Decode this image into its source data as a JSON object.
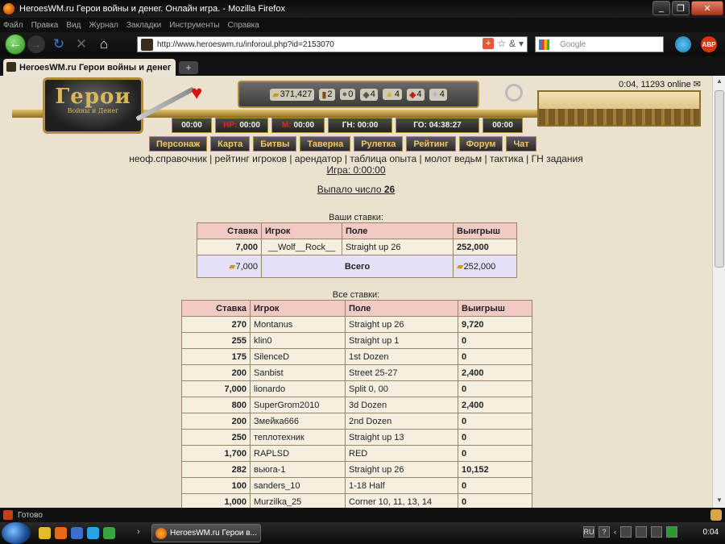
{
  "window": {
    "title": "HeroesWM.ru Герои войны и денег. Онлайн игра. - Mozilla Firefox",
    "buttons": [
      "_",
      "❐",
      "✕"
    ]
  },
  "menubar": [
    "Файл",
    "Правка",
    "Вид",
    "Журнал",
    "Закладки",
    "Инструменты",
    "Справка"
  ],
  "nav": {
    "url": "http://www.heroeswm.ru/inforoul.php?id=2153070",
    "search_placeholder": "Google"
  },
  "tab": {
    "title": "HeroesWM.ru Герои войны и денег",
    "new_tab": "+"
  },
  "game": {
    "logo_text": "Герои",
    "logo_sub": "Войны и Денег",
    "online": "0:04, 11293 online",
    "resources": [
      "371,427",
      "2",
      "0",
      "4",
      "4",
      "4",
      "4"
    ],
    "resource_icons": [
      "gold-icon",
      "wood-icon",
      "ore-icon",
      "mercury-icon",
      "sulfur-icon",
      "crystal-icon",
      "gems-icon"
    ],
    "timers": [
      {
        "label": "00:00",
        "width": 50
      },
      {
        "prefix": "HP:",
        "label": "00:00",
        "width": 66
      },
      {
        "prefix": "M:",
        "label": "00:00",
        "width": 66
      },
      {
        "label": "ГН: 00:00",
        "width": 80
      },
      {
        "label": "ГО: 04:38:27",
        "width": 104
      },
      {
        "label": "00:00",
        "width": 50
      }
    ],
    "menu": [
      "Персонаж",
      "Карта",
      "Битвы",
      "Таверна",
      "Рулетка",
      "Рейтинг",
      "Форум",
      "Чат"
    ],
    "links": [
      "неоф.справочник",
      "рейтинг игроков",
      "арендатор",
      "таблица опыта",
      "молот ведьм",
      "тактика",
      "ГН задания"
    ],
    "game_time": "Игра: 0:00:00"
  },
  "result": {
    "label": "Выпало число",
    "number": "26"
  },
  "your_bets": {
    "title": "Ваши ставки:",
    "headers": [
      "Ставка",
      "Игрок",
      "Поле",
      "Выигрыш"
    ],
    "rows": [
      [
        "7,000",
        "__Wolf__Rock__",
        "Straight up 26",
        "252,000"
      ]
    ],
    "total": {
      "bet": "7,000",
      "label": "Всего",
      "win": "252,000"
    }
  },
  "all_bets": {
    "title": "Все ставки:",
    "headers": [
      "Ставка",
      "Игрок",
      "Поле",
      "Выигрыш"
    ],
    "rows": [
      [
        "270",
        "Montanus",
        "Straight up 26",
        "9,720"
      ],
      [
        "255",
        "klin0",
        "Straight up 1",
        "0"
      ],
      [
        "175",
        "SilenceD",
        "1st Dozen",
        "0"
      ],
      [
        "200",
        "Sanbist",
        "Street 25-27",
        "2,400"
      ],
      [
        "7,000",
        "lionardo",
        "Split 0, 00",
        "0"
      ],
      [
        "800",
        "SuperGrom2010",
        "3d Dozen",
        "2,400"
      ],
      [
        "200",
        "Змейка666",
        "2nd Dozen",
        "0"
      ],
      [
        "250",
        "теплотехник",
        "Straight up 13",
        "0"
      ],
      [
        "1,700",
        "RAPLSD",
        "RED",
        "0"
      ],
      [
        "282",
        "вьюга-1",
        "Straight up 26",
        "10,152"
      ],
      [
        "100",
        "sanders_10",
        "1-18 Half",
        "0"
      ],
      [
        "1,000",
        "Murzilka_25",
        "Corner 10, 11, 13, 14",
        "0"
      ]
    ]
  },
  "status": "Готово",
  "taskbar": {
    "button": "HeroesWM.ru Герои в...",
    "lang": "RU",
    "help": "?",
    "clock": "0:04"
  }
}
